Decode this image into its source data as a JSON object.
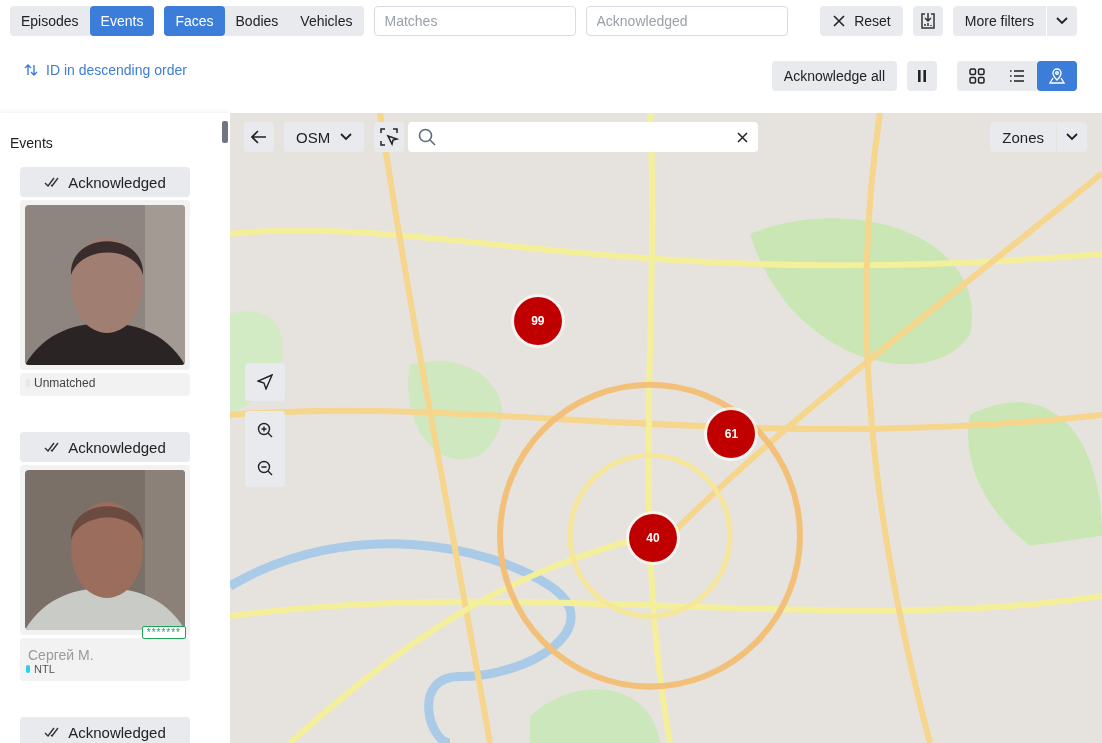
{
  "mode_tabs": [
    {
      "label": "Episodes",
      "selected": false
    },
    {
      "label": "Events",
      "selected": true
    }
  ],
  "object_tabs": [
    {
      "label": "Faces",
      "selected": true
    },
    {
      "label": "Bodies",
      "selected": false
    },
    {
      "label": "Vehicles",
      "selected": false
    }
  ],
  "filters": [
    {
      "placeholder": "Matches"
    },
    {
      "placeholder": "Acknowledged"
    }
  ],
  "reset_button": "Reset",
  "more_filters": "More filters",
  "sort": "ID in descending order",
  "acknowledge_all": "Acknowledge all",
  "views": [
    {
      "kind": "grid",
      "selected": false
    },
    {
      "kind": "list",
      "selected": false
    },
    {
      "kind": "map",
      "selected": true
    }
  ],
  "sidebar": {
    "title": "Events",
    "events": [
      {
        "status": "Acknowledged",
        "match": "Unmatched",
        "matched": false,
        "color": "#e5e7eb"
      },
      {
        "status": "Acknowledged",
        "match": "Сергей М.",
        "matched": true,
        "badge": "*******",
        "list": "NTL",
        "color": "#22d3ee"
      },
      {
        "status": "Acknowledged"
      }
    ]
  },
  "map": {
    "layer": "OSM",
    "zones": "Zones",
    "clusters": [
      "99",
      "61",
      "40"
    ]
  }
}
